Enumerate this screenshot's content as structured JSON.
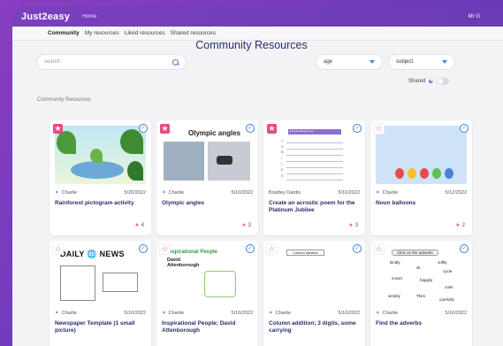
{
  "app": {
    "logo": "Just2easy",
    "home": "Home",
    "user": "Mr G"
  },
  "subnav": [
    "Community",
    "My resources",
    "Liked resources",
    "Shared resources"
  ],
  "page_title": "Community Resources",
  "search": {
    "placeholder": "search"
  },
  "filters": {
    "age": "age",
    "subject": "subject"
  },
  "shared_toggle": {
    "label": "Shared",
    "on": false
  },
  "section_label": "Community Resources",
  "cards": [
    {
      "author": "Charlie",
      "date": "5/20/2022",
      "title": "Rainforest pictogram activity",
      "likes": "4",
      "starred": true
    },
    {
      "author": "Charlie",
      "date": "5/10/2022",
      "title": "Olympic angles",
      "likes": "3",
      "starred": true,
      "thumb_title": "Olympic angles"
    },
    {
      "author": "Bradley Dardis",
      "date": "5/10/2022",
      "title": "Create an acrostic poem for the Platinum Jubilee",
      "likes": "3",
      "starred": true,
      "thumb_title": "First Amazing Poem",
      "acrostic_letters": [
        "J",
        "U",
        "B",
        "I",
        "L",
        "E",
        "E"
      ]
    },
    {
      "author": "Charlie",
      "date": "5/12/2022",
      "title": "Noun balloons",
      "likes": "2",
      "starred": false
    },
    {
      "author": "Charlie",
      "date": "5/10/2022",
      "title": "Newspaper Template (1 small picture)",
      "starred": false,
      "thumb_title_a": "DAILY",
      "thumb_title_b": "NEWS"
    },
    {
      "author": "Charlie",
      "date": "5/10/2022",
      "title": "Inspirational People; David Attenborough",
      "starred": false,
      "thumb_title": "Inspirational People",
      "thumb_sub": "David Attenborough"
    },
    {
      "author": "Charlie",
      "date": "5/10/2022",
      "title": "Column addition; 3 digits, some carrying",
      "starred": false,
      "thumb_title": "Column addition"
    },
    {
      "author": "Charlie",
      "date": "5/10/2022",
      "title": "Find the adverbs",
      "starred": false,
      "thumb_title": "Click on the adverbs",
      "adverbs": [
        "kindly",
        "sit",
        "softly",
        "cycle",
        "crown",
        "happily",
        "calm",
        "wrinkly",
        "Then",
        "carefully"
      ]
    }
  ]
}
